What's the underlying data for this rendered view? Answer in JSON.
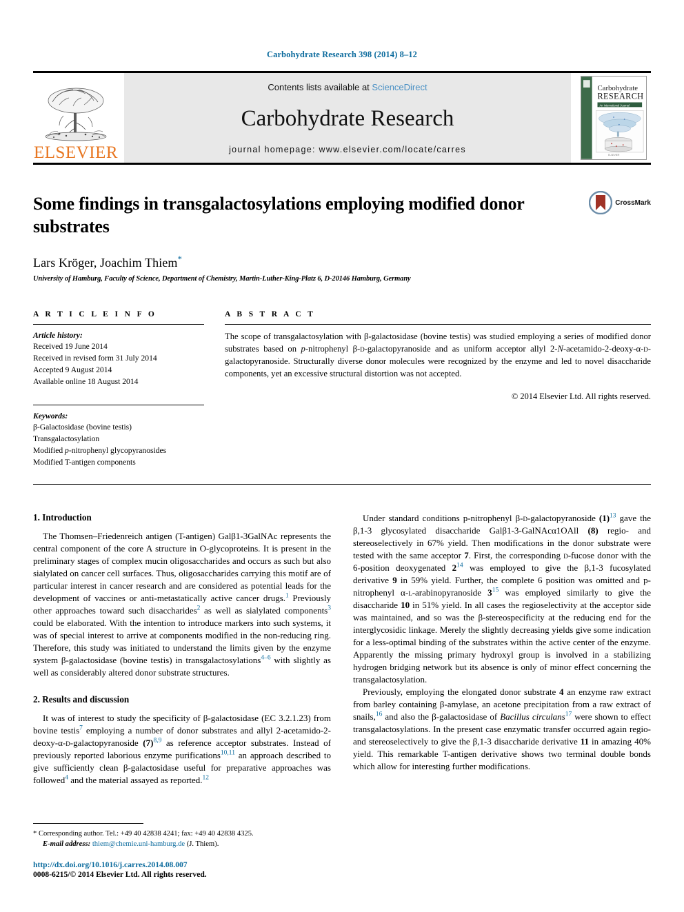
{
  "running_head": "Carbohydrate Research 398 (2014) 8–12",
  "masthead": {
    "publisher_name": "ELSEVIER",
    "contents_prefix": "Contents lists available at ",
    "sciencedirect": "ScienceDirect",
    "journal_name": "Carbohydrate Research",
    "homepage": "journal homepage: www.elsevier.com/locate/carres",
    "cover": {
      "line1": "Carbohydrate",
      "line2": "RESEARCH",
      "subtitle": "An International Journal"
    }
  },
  "article": {
    "title": "Some findings in transgalactosylations employing modified donor substrates",
    "authors": "Lars Kröger, Joachim Thiem",
    "author_marker": "*",
    "affiliation": "University of Hamburg, Faculty of Science, Department of Chemistry, Martin-Luther-King-Platz 6, D-20146 Hamburg, Germany",
    "crossmark_label": "CrossMark"
  },
  "article_info": {
    "heading": "A R T I C L E   I N F O",
    "history_label": "Article history:",
    "history": [
      "Received 19 June 2014",
      "Received in revised form 31 July 2014",
      "Accepted 9 August 2014",
      "Available online 18 August 2014"
    ],
    "keywords_label": "Keywords:",
    "keywords": [
      "β-Galactosidase (bovine testis)",
      "Transgalactosylation",
      "Modified p-nitrophenyl glycopyranosides",
      "Modified T-antigen components"
    ]
  },
  "abstract": {
    "heading": "A B S T R A C T",
    "text": "The scope of transgalactosylation with β-galactosidase (bovine testis) was studied employing a series of modified donor substrates based on p-nitrophenyl β-D-galactopyranoside and as uniform acceptor allyl 2-N-acetamido-2-deoxy-α-D-galactopyranoside. Structurally diverse donor molecules were recognized by the enzyme and led to novel disaccharide components, yet an excessive structural distortion was not accepted.",
    "copyright": "© 2014 Elsevier Ltd. All rights reserved."
  },
  "sections": {
    "introduction_heading": "1. Introduction",
    "introduction_p1": "The Thomsen–Friedenreich antigen (T-antigen) Galβ1-3GalNAc represents the central component of the core A structure in O-glycoproteins. It is present in the preliminary stages of complex mucin oligosaccharides and occurs as such but also sialylated on cancer cell surfaces. Thus, oligosaccharides carrying this motif are of particular interest in cancer research and are considered as potential leads for the development of vaccines or anti-metastatically active cancer drugs.1 Previously other approaches toward such disaccharides2 as well as sialylated components3 could be elaborated. With the intention to introduce markers into such systems, it was of special interest to arrive at components modified in the non-reducing ring. Therefore, this study was initiated to understand the limits given by the enzyme system β-galactosidase (bovine testis) in transgalactosylations4–6 with slightly as well as considerably altered donor substrate structures.",
    "results_heading": "2. Results and discussion",
    "results_p1": "It was of interest to study the specificity of β-galactosidase (EC 3.2.1.23) from bovine testis7 employing a number of donor substrates and allyl 2-acetamido-2-deoxy-α-D-galactopyranoside (7)8,9 as reference acceptor substrates. Instead of previously reported laborious enzyme purifications10,11 an approach described to give sufficiently clean β-galactosidase useful for preparative approaches was followed4 and the material assayed as reported.12",
    "results_p2": "Under standard conditions p-nitrophenyl β-D-galactopyranoside (1)13 gave the β,1-3 glycosylated disaccharide Galβ1-3-GalNAcα1OAll (8) regio- and stereoselectively in 67% yield. Then modifications in the donor substrate were tested with the same acceptor 7. First, the corresponding D-fucose donor with the 6-position deoxygenated 214 was employed to give the β,1-3 fucosylated derivative 9 in 59% yield. Further, the complete 6 position was omitted and p-nitrophenyl α-L-arabinopyranoside 315 was employed similarly to give the disaccharide 10 in 51% yield. In all cases the regioselectivity at the acceptor side was maintained, and so was the β-stereospecificity at the reducing end for the interglycosidic linkage. Merely the slightly decreasing yields give some indication for a less-optimal binding of the substrates within the active center of the enzyme. Apparently the missing primary hydroxyl group is involved in a stabilizing hydrogen bridging network but its absence is only of minor effect concerning the transgalactosylation.",
    "results_p3": "Previously, employing the elongated donor substrate 4 an enzyme raw extract from barley containing β-amylase, an acetone precipitation from a raw extract of snails,16 and also the β-galactosidase of Bacillus circulans17 were shown to effect transgalactosylations. In the present case enzymatic transfer occurred again regio- and stereoselectively to give the β,1-3 disaccharide derivative 11 in amazing 40% yield. This remarkable T-antigen derivative shows two terminal double bonds which allow for interesting further modifications."
  },
  "footnote": {
    "corresponding": "* Corresponding author. Tel.: +49 40 42838 4241; fax: +49 40 42838 4325.",
    "email_label": "E-mail address:",
    "email": "thiem@chemie.uni-hamburg.de",
    "email_suffix": "(J. Thiem).",
    "doi": "http://dx.doi.org/10.1016/j.carres.2014.08.007",
    "issn": "0008-6215/© 2014 Elsevier Ltd. All rights reserved."
  },
  "colors": {
    "link_blue": "#0d6c9e",
    "elsevier_orange": "#E87722",
    "sciencedirect_blue": "#4a90c4",
    "panel_grey": "#e8e8e8"
  }
}
